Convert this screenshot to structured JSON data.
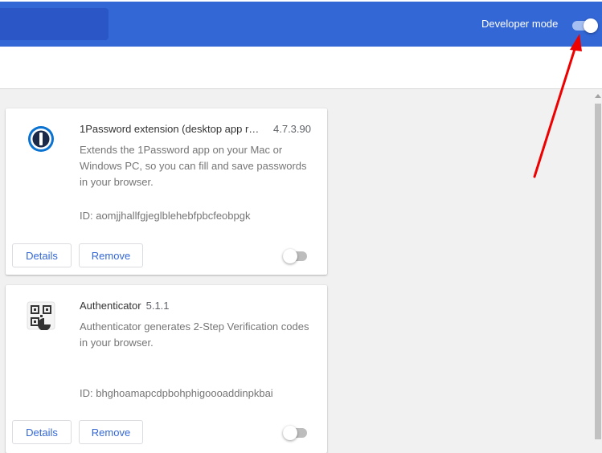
{
  "header": {
    "developer_mode_label": "Developer mode",
    "developer_mode_on": true,
    "accent_color": "#3367d6"
  },
  "extensions": [
    {
      "name": "1Password extension (desktop app re...",
      "version": "4.7.3.90",
      "description": "Extends the 1Password app on your Mac or Windows PC, so you can fill and save passwords in your browser.",
      "id_text": "ID: aomjjhallfgjeglblehebfpbcfeobpgk",
      "details_label": "Details",
      "remove_label": "Remove",
      "enabled": false,
      "icon": "1password-icon"
    },
    {
      "name": "Authenticator",
      "version": "5.1.1",
      "description": "Authenticator generates 2-Step Verification codes in your browser.",
      "id_text": "ID: bhghoamapcdpbohphigoooaddinpkbai",
      "details_label": "Details",
      "remove_label": "Remove",
      "enabled": false,
      "icon": "authenticator-qr-icon"
    }
  ],
  "annotation": {
    "arrow_color": "#ee0000",
    "points_to": "developer-mode-toggle"
  }
}
